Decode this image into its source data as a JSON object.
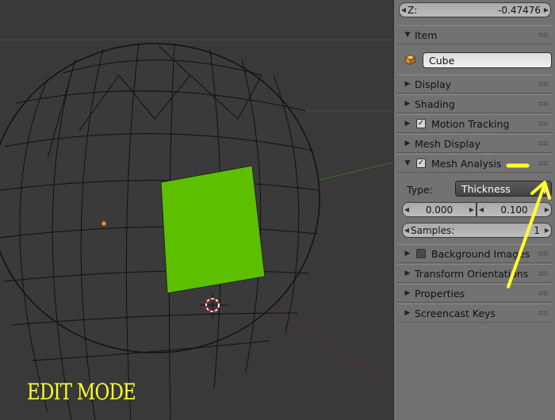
{
  "viewport": {
    "mode_label": "EDIT MODE",
    "colors": {
      "background": "#393939",
      "wire": "#111111",
      "selected_face": "#5cbf00",
      "annotation": "#ffff2e"
    }
  },
  "properties_panel": {
    "z_field": {
      "label": "Z:",
      "value": "-0.47476"
    },
    "item": {
      "header": "Item",
      "object_icon": "cube-icon",
      "object_name": "Cube"
    },
    "sections_top": [
      "Display",
      "Shading"
    ],
    "motion_tracking": {
      "label": "Motion Tracking",
      "checked": true
    },
    "mesh_display": "Mesh Display",
    "mesh_analysis": {
      "label": "Mesh Analysis",
      "checked": true,
      "type_label": "Type:",
      "type_value": "Thickness",
      "min_value": "0.000",
      "max_value": "0.100",
      "samples_label": "Samples:",
      "samples_value": "1"
    },
    "background_images": {
      "label": "Background Images",
      "checked": false
    },
    "sections_bottom": [
      "Transform Orientations",
      "Properties",
      "Screencast Keys"
    ]
  }
}
